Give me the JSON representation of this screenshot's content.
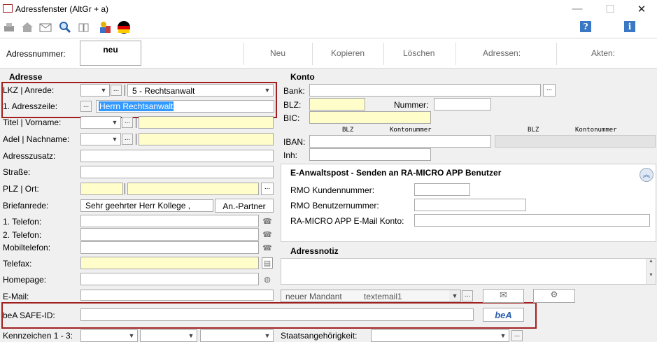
{
  "window": {
    "title": "Adressfenster (AltGr + a)"
  },
  "toolbar": {
    "help_label": "?",
    "info_label": "i"
  },
  "topbar": {
    "adressnummer_label": "Adressnummer:",
    "adressnummer_value": "neu",
    "neu": "Neu",
    "kopieren": "Kopieren",
    "loeschen": "Löschen",
    "adressen": "Adressen:",
    "akten": "Akten:"
  },
  "adresse": {
    "header": "Adresse",
    "lkz_label": "LKZ | Anrede:",
    "anrede_value": "5   - Rechtsanwalt",
    "adresszeile_label": "1. Adresszeile:",
    "adresszeile_value": "Herrn Rechtsanwalt",
    "titel_label": "Titel | Vorname:",
    "adel_label": "Adel | Nachname:",
    "adresszusatz_label": "Adresszusatz:",
    "strasse_label": "Straße:",
    "plz_label": "PLZ | Ort:",
    "briefanrede_label": "Briefanrede:",
    "briefanrede_value": "Sehr geehrter Herr Kollege ,",
    "anpartner_button": "An.-Partner",
    "telefon1_label": "1. Telefon:",
    "telefon2_label": "2. Telefon:",
    "mobil_label": "Mobiltelefon:",
    "telefax_label": "Telefax:",
    "homepage_label": "Homepage:",
    "email_label": "E-Mail:",
    "bea_label": "beA SAFE-ID:",
    "kennzeichen_label": "Kennzeichen 1 - 3:"
  },
  "konto": {
    "header": "Konto",
    "bank_label": "Bank:",
    "blz_label": "BLZ:",
    "nummer_label": "Nummer:",
    "bic_label": "BIC:",
    "col_blz": "BLZ",
    "col_kontonummer": "Kontonummer",
    "col_blz2": "BLZ",
    "col_kontonummer2": "Kontonummer",
    "iban_label": "IBAN:",
    "inh_label": "Inh:"
  },
  "eanwalt": {
    "header": "E-Anwaltspost - Senden an RA-MICRO APP Benutzer",
    "kunden_label": "RMO Kundennummer:",
    "benutzer_label": "RMO Benutzernummer:",
    "email_label": "RA-MICRO APP E-Mail Konto:"
  },
  "adressnotiz": {
    "header": "Adressnotiz"
  },
  "mandant": {
    "mandant_value": "neuer Mandant",
    "template_value": "textemail1"
  },
  "bea_button": "beA",
  "staat_label": "Staatsangehörigkeit:",
  "colors": {
    "highlight_border": "#a02020",
    "yellow_field": "#fffdc9",
    "selection": "#3399ff"
  }
}
